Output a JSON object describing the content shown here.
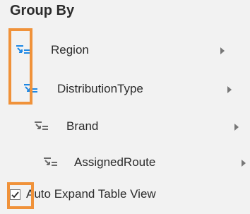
{
  "panel": {
    "title": "Group By",
    "items": [
      {
        "label": "Region",
        "icon": "group-hierarchy-icon",
        "icon_color": "#1e88e5"
      },
      {
        "label": "DistributionType",
        "icon": "group-hierarchy-icon",
        "icon_color": "#1e88e5"
      },
      {
        "label": "Brand",
        "icon": "group-hierarchy-icon",
        "icon_color": "#6b6b6b"
      },
      {
        "label": "AssignedRoute",
        "icon": "group-hierarchy-icon",
        "icon_color": "#6b6b6b"
      }
    ],
    "auto_expand": {
      "label": "Auto Expand Table View",
      "checked": true
    }
  },
  "colors": {
    "highlight": "#f0923a",
    "active_icon": "#1e88e5",
    "inactive_icon": "#6b6b6b",
    "chevron": "#777777"
  }
}
